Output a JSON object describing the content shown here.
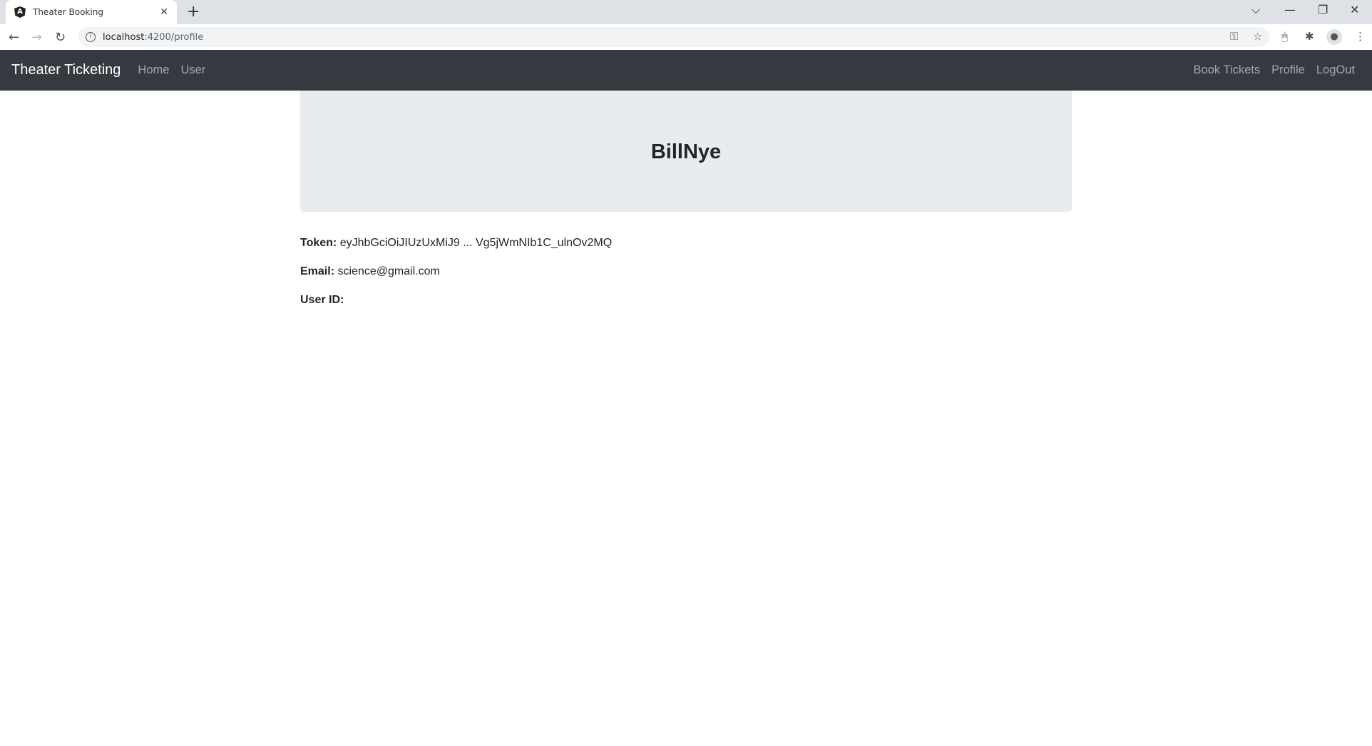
{
  "browser": {
    "tab_title": "Theater Booking",
    "tab_icon": "angular-icon",
    "url_host": "localhost",
    "url_path": ":4200/profile"
  },
  "navbar": {
    "brand": "Theater Ticketing",
    "left_links": [
      "Home",
      "User"
    ],
    "right_links": [
      "Book Tickets",
      "Profile",
      "LogOut"
    ]
  },
  "profile": {
    "username": "BillNye",
    "token_label": "Token:",
    "token_value": "eyJhbGciOiJIUzUxMiJ9 ... Vg5jWmNIb1C_ulnOv2MQ",
    "email_label": "Email:",
    "email_value": "science@gmail.com",
    "userid_label": "User ID:",
    "userid_value": ""
  }
}
